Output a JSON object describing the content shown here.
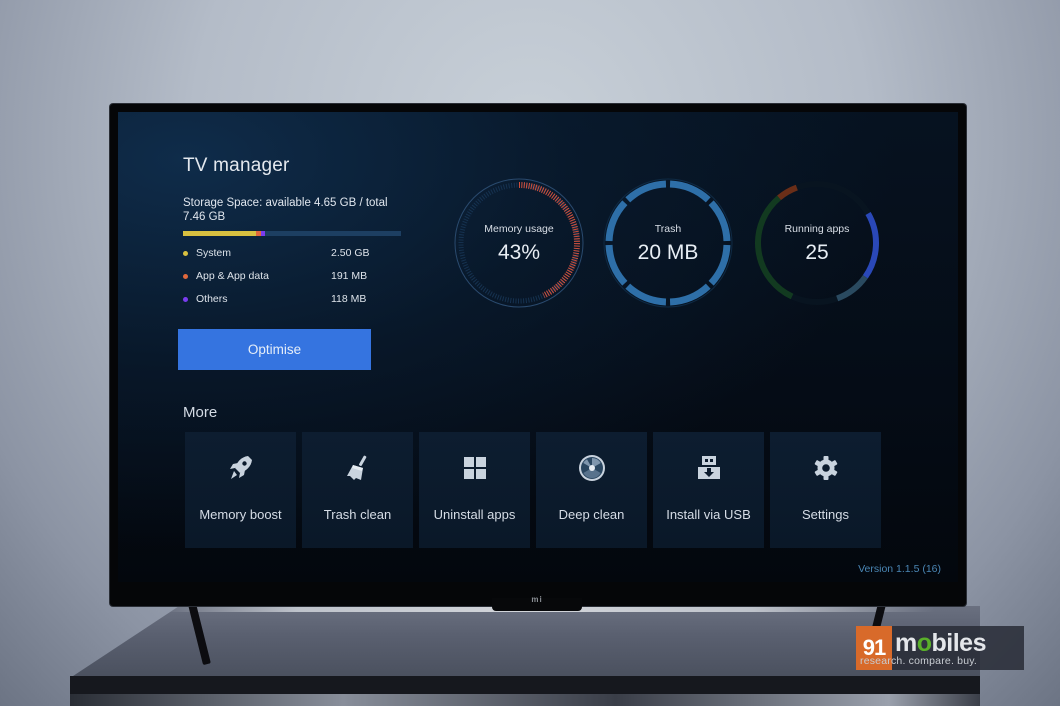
{
  "screen": {
    "title": "TV manager",
    "storage": {
      "label": "Storage Space: available 4.65 GB / total 7.46 GB",
      "available_gb": 4.65,
      "total_gb": 7.46,
      "segments": [
        {
          "name": "System",
          "value": "2.50 GB",
          "fraction": 0.335,
          "color": "#d8c040"
        },
        {
          "name": "App & App data",
          "value": "191 MB",
          "fraction": 0.025,
          "color": "#e0683c"
        },
        {
          "name": "Others",
          "value": "118 MB",
          "fraction": 0.016,
          "color": "#7a3cf0"
        }
      ],
      "bar_track_color": "#1d3f62"
    },
    "optimise_button": "Optimise",
    "gauges": [
      {
        "label": "Memory usage",
        "value": "43%",
        "fraction": 0.43,
        "accent": "#d2503c",
        "track": "#2a4a6e"
      },
      {
        "label": "Trash",
        "value": "20 MB",
        "accent": "#2e6fa8",
        "track": "#2e6fa8"
      },
      {
        "label": "Running apps",
        "value": "25",
        "accent": "#2a48b8",
        "track": "#12301e"
      }
    ],
    "more": {
      "title": "More",
      "tiles": [
        {
          "label": "Memory boost",
          "icon": "rocket-icon"
        },
        {
          "label": "Trash clean",
          "icon": "broom-icon"
        },
        {
          "label": "Uninstall apps",
          "icon": "grid-icon"
        },
        {
          "label": "Deep clean",
          "icon": "disc-icon"
        },
        {
          "label": "Install via USB",
          "icon": "usb-download-icon"
        },
        {
          "label": "Settings",
          "icon": "gear-icon"
        }
      ]
    },
    "version": "Version 1.1.5 (16)"
  },
  "tv": {
    "brand_logo": "mi"
  },
  "watermark": {
    "number": "91",
    "brand_pre": "m",
    "brand_o": "o",
    "brand_post": "biles",
    "tagline": "research. compare. buy."
  }
}
